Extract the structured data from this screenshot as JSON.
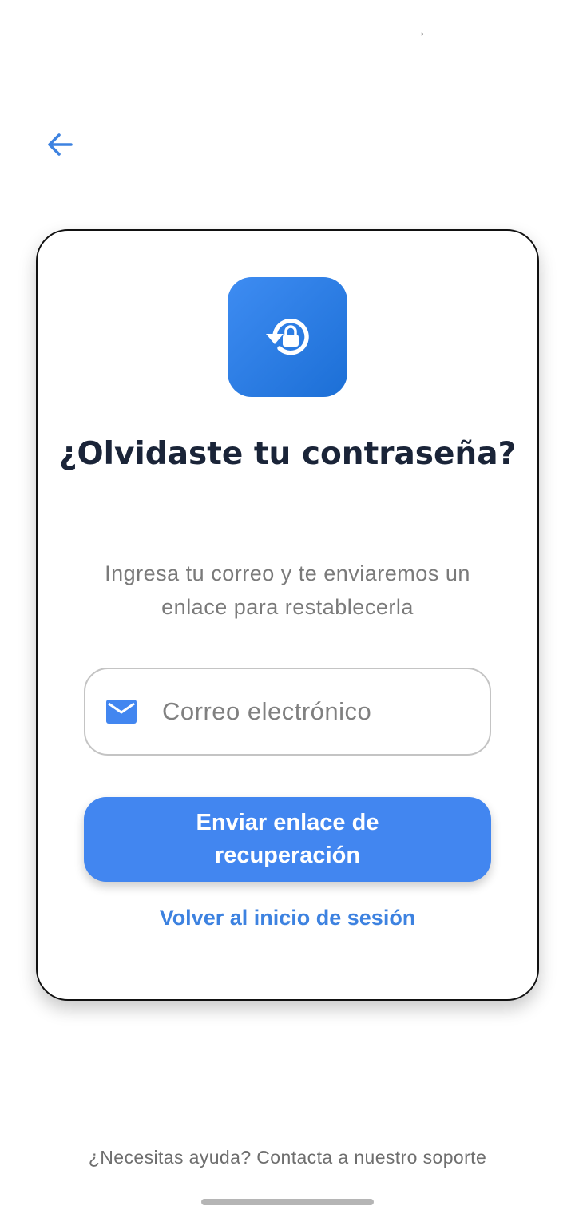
{
  "status_bar": {
    "glyph": "˒"
  },
  "header": {
    "back_icon": "arrow-left-icon"
  },
  "card": {
    "icon": "lock-reset-icon",
    "title": "¿Olvidaste tu contraseña?",
    "subtitle": "Ingresa tu correo y te enviaremos un enlace para restablecerla",
    "email_field": {
      "icon": "mail-icon",
      "placeholder": "Correo electrónico",
      "value": ""
    },
    "send_button_label": "Enviar enlace de recuperación",
    "back_to_login_label": "Volver al inicio de sesión"
  },
  "footer": {
    "help_text": "¿Necesitas ayuda? Contacta a nuestro soporte"
  },
  "colors": {
    "accent": "#4286f0",
    "link": "#3d82e0",
    "title": "#1a2438",
    "muted": "#7a7a7a"
  }
}
